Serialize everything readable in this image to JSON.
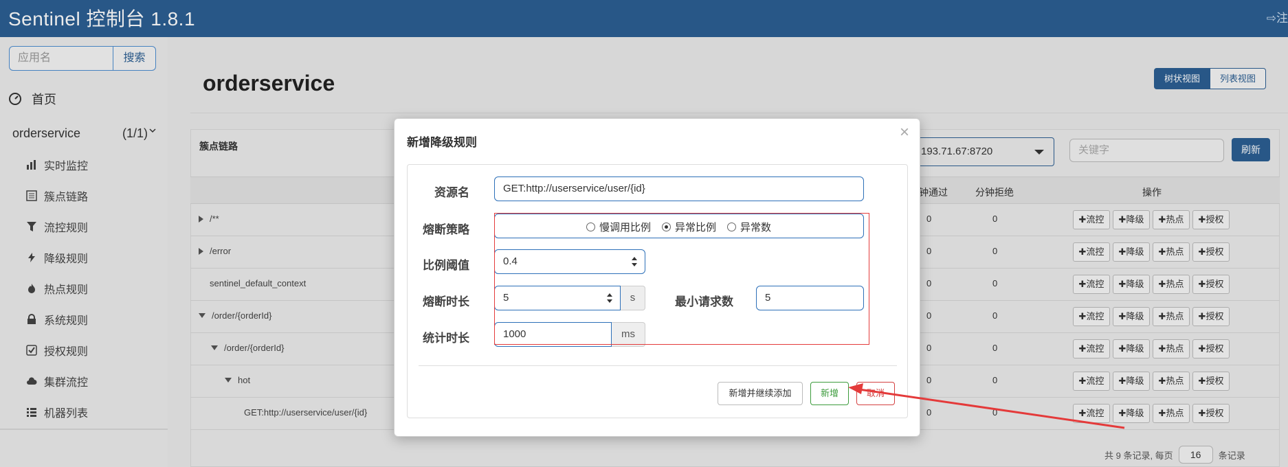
{
  "header": {
    "brand": "Sentinel 控制台 1.8.1",
    "logout_partial": "⇨注"
  },
  "sidebar": {
    "search_placeholder": "应用名",
    "search_button": "搜索",
    "home": "首页",
    "app": {
      "name": "orderservice",
      "count": "(1/1)"
    },
    "items": [
      {
        "label": "实时监控",
        "icon": "bar-chart-icon"
      },
      {
        "label": "簇点链路",
        "icon": "list-icon"
      },
      {
        "label": "流控规则",
        "icon": "filter-icon"
      },
      {
        "label": "降级规则",
        "icon": "flash-icon"
      },
      {
        "label": "热点规则",
        "icon": "fire-icon"
      },
      {
        "label": "系统规则",
        "icon": "lock-icon"
      },
      {
        "label": "授权规则",
        "icon": "check-icon"
      },
      {
        "label": "集群流控",
        "icon": "cloud-icon"
      },
      {
        "label": "机器列表",
        "icon": "th-list-icon"
      }
    ]
  },
  "main": {
    "title": "orderservice",
    "view_tree": "树状视图",
    "view_list": "列表视图",
    "panel_title": "簇点链路",
    "ip_select": "193.71.67:8720",
    "keyword_placeholder": "关键字",
    "refresh": "刷新",
    "columns": {
      "pass": "钟通过",
      "reject": "分钟拒绝",
      "ops": "操作"
    },
    "ops_labels": [
      "✚流控",
      "✚降级",
      "✚热点",
      "✚授权"
    ],
    "rows": [
      {
        "name": "/**",
        "pass": "0",
        "reject": "0"
      },
      {
        "name": "/error",
        "pass": "0",
        "reject": "0"
      },
      {
        "name": "sentinel_default_context",
        "pass": "0",
        "reject": "0"
      },
      {
        "name": "/order/{orderId}",
        "pass": "0",
        "reject": "0"
      },
      {
        "name": "/order/{orderId}",
        "pass": "0",
        "reject": "0"
      },
      {
        "name": "hot",
        "pass": "0",
        "reject": "0"
      },
      {
        "name": "GET:http://userservice/user/{id}",
        "pass": "0",
        "reject": "0"
      }
    ],
    "pager": {
      "prefix": "共 9 条记录, 每页",
      "page_size": "16",
      "suffix": "条记录"
    }
  },
  "modal": {
    "title": "新增降级规则",
    "close": "×",
    "resource_label": "资源名",
    "resource_value": "GET:http://userservice/user/{id}",
    "strategy_label": "熔断策略",
    "strategy_options": [
      "慢调用比例",
      "异常比例",
      "异常数"
    ],
    "strategy_selected": "异常比例",
    "ratio_label": "比例阈值",
    "ratio_value": "0.4",
    "duration_label": "熔断时长",
    "duration_value": "5",
    "duration_unit": "s",
    "min_req_label": "最小请求数",
    "min_req_value": "5",
    "stat_label": "统计时长",
    "stat_value": "1000",
    "stat_unit": "ms",
    "btn_add_continue": "新增并继续添加",
    "btn_add": "新增",
    "btn_cancel": "取消"
  },
  "colors": {
    "header": "#2c5f93",
    "highlight": "#e43a3a",
    "add_button": "#3c9b3c"
  }
}
